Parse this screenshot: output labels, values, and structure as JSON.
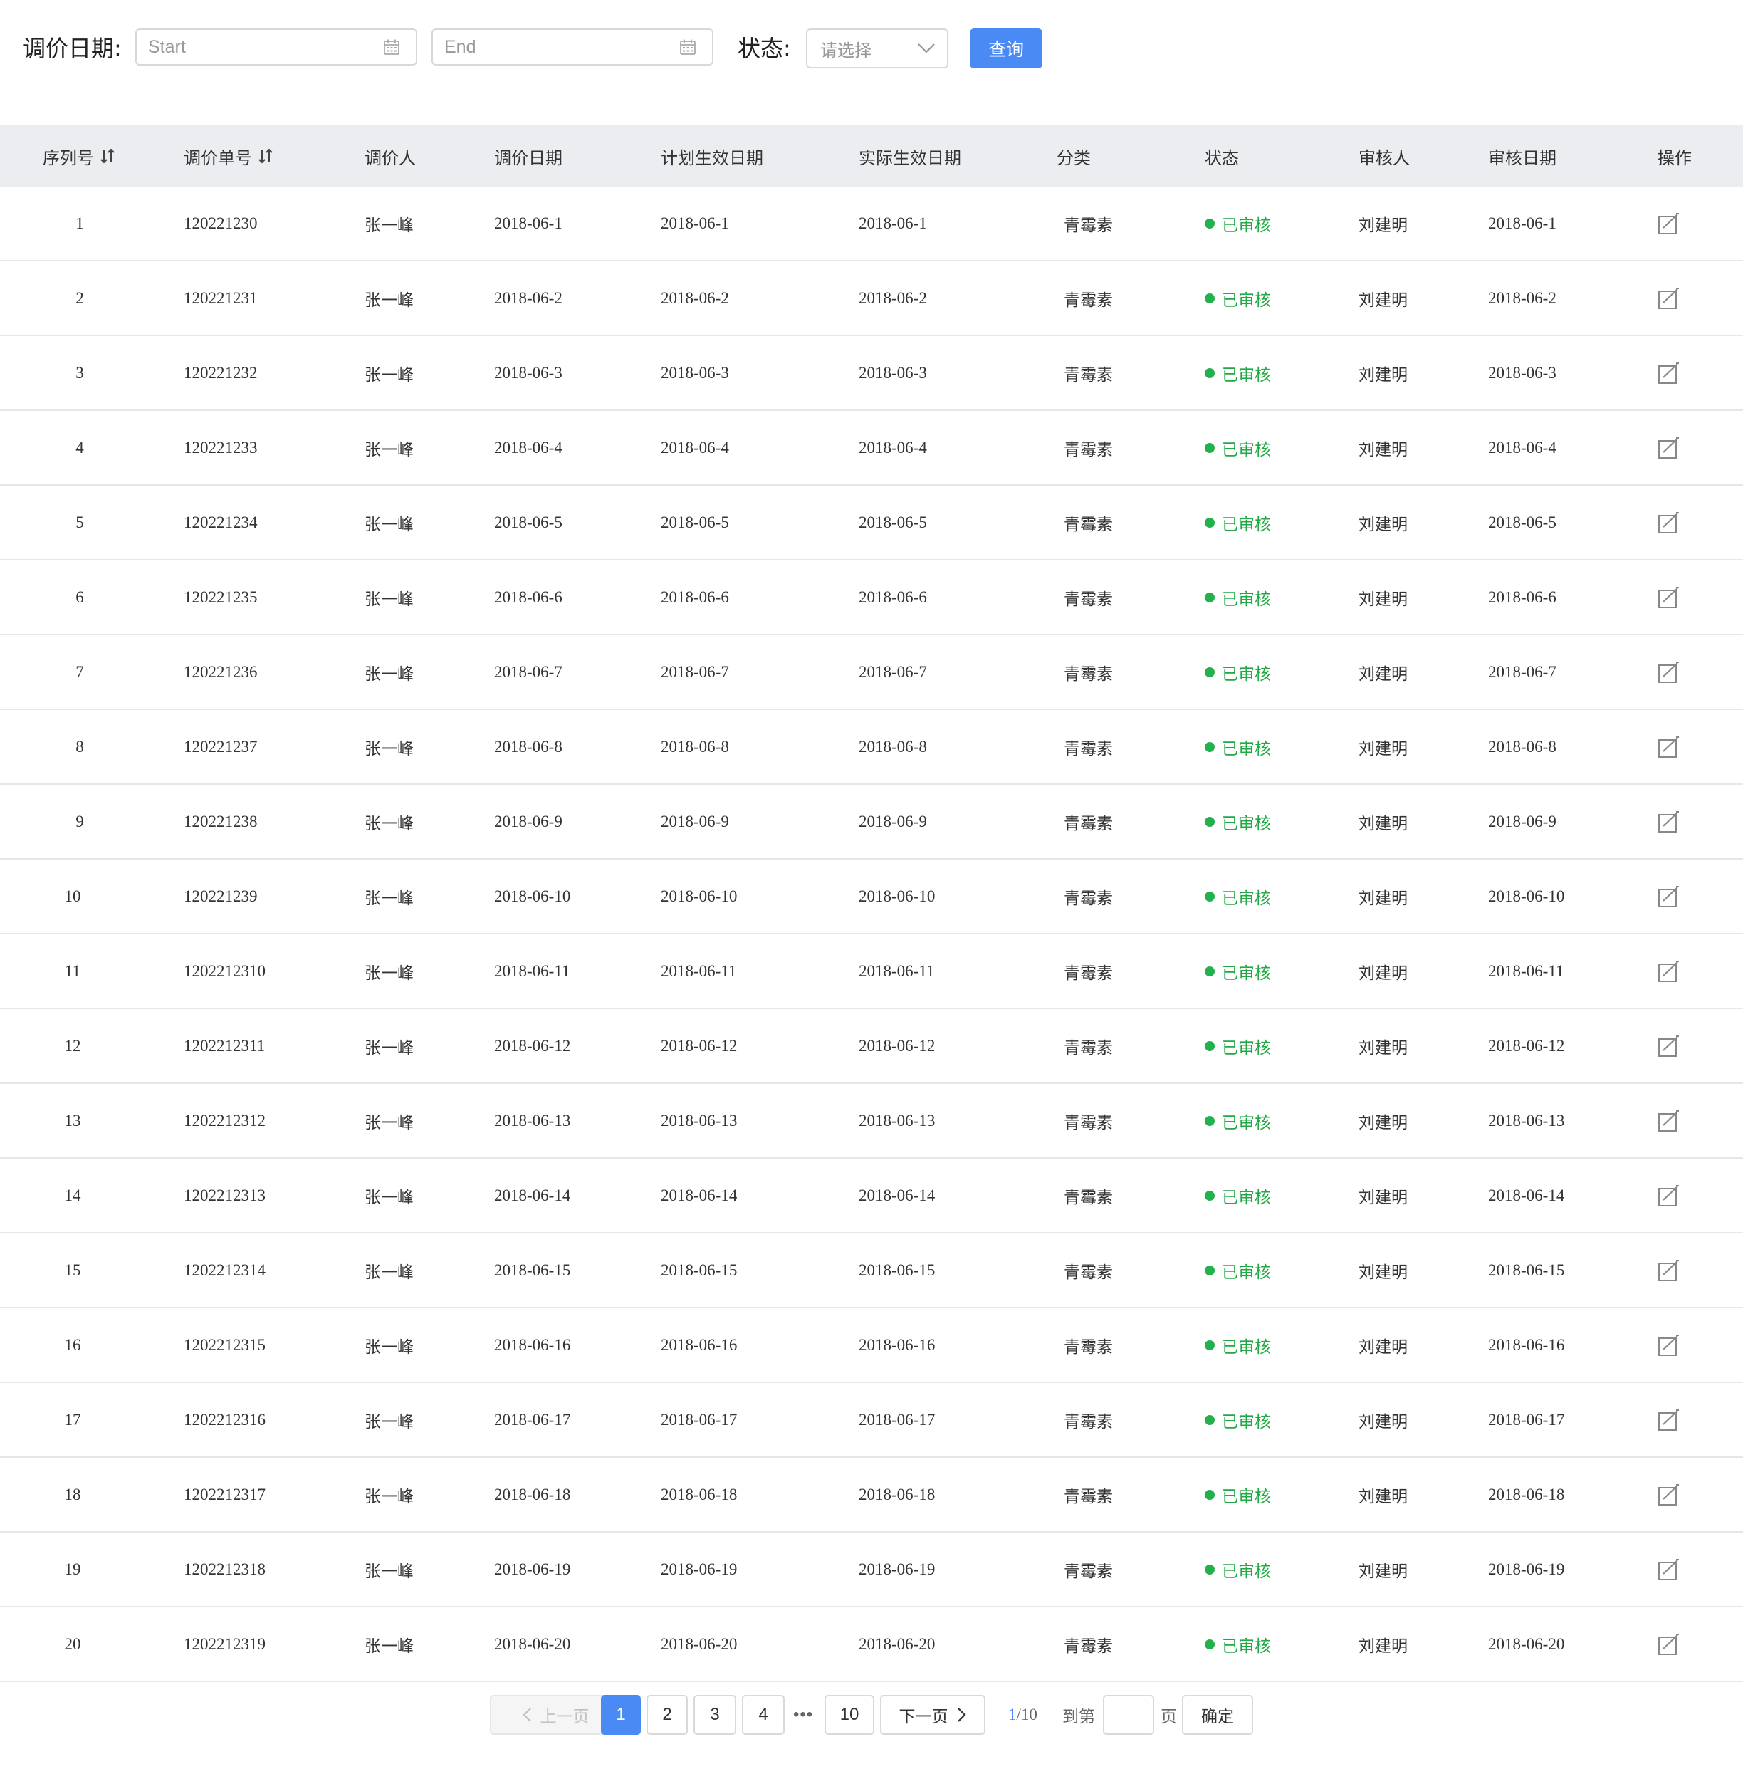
{
  "filter": {
    "date_label": "调价日期:",
    "start_placeholder": "Start",
    "end_placeholder": "End",
    "status_label": "状态:",
    "status_placeholder": "请选择",
    "query_button": "查询"
  },
  "table": {
    "columns": [
      "序列号",
      "调价单号",
      "调价人",
      "调价日期",
      "计划生效日期",
      "实际生效日期",
      "分类",
      "状态",
      "审核人",
      "审核日期",
      "操作"
    ],
    "sortable_columns": [
      "序列号",
      "调价单号"
    ],
    "status_color": "#22a845",
    "rows": [
      {
        "seq": "1",
        "order": "120221230",
        "person": "张一峰",
        "date": "2018-06-1",
        "planned": "2018-06-1",
        "actual": "2018-06-1",
        "category": "青霉素",
        "status": "已审核",
        "reviewer": "刘建明",
        "review_date": "2018-06-1"
      },
      {
        "seq": "2",
        "order": "120221231",
        "person": "张一峰",
        "date": "2018-06-2",
        "planned": "2018-06-2",
        "actual": "2018-06-2",
        "category": "青霉素",
        "status": "已审核",
        "reviewer": "刘建明",
        "review_date": "2018-06-2"
      },
      {
        "seq": "3",
        "order": "120221232",
        "person": "张一峰",
        "date": "2018-06-3",
        "planned": "2018-06-3",
        "actual": "2018-06-3",
        "category": "青霉素",
        "status": "已审核",
        "reviewer": "刘建明",
        "review_date": "2018-06-3"
      },
      {
        "seq": "4",
        "order": "120221233",
        "person": "张一峰",
        "date": "2018-06-4",
        "planned": "2018-06-4",
        "actual": "2018-06-4",
        "category": "青霉素",
        "status": "已审核",
        "reviewer": "刘建明",
        "review_date": "2018-06-4"
      },
      {
        "seq": "5",
        "order": "120221234",
        "person": "张一峰",
        "date": "2018-06-5",
        "planned": "2018-06-5",
        "actual": "2018-06-5",
        "category": "青霉素",
        "status": "已审核",
        "reviewer": "刘建明",
        "review_date": "2018-06-5"
      },
      {
        "seq": "6",
        "order": "120221235",
        "person": "张一峰",
        "date": "2018-06-6",
        "planned": "2018-06-6",
        "actual": "2018-06-6",
        "category": "青霉素",
        "status": "已审核",
        "reviewer": "刘建明",
        "review_date": "2018-06-6"
      },
      {
        "seq": "7",
        "order": "120221236",
        "person": "张一峰",
        "date": "2018-06-7",
        "planned": "2018-06-7",
        "actual": "2018-06-7",
        "category": "青霉素",
        "status": "已审核",
        "reviewer": "刘建明",
        "review_date": "2018-06-7"
      },
      {
        "seq": "8",
        "order": "120221237",
        "person": "张一峰",
        "date": "2018-06-8",
        "planned": "2018-06-8",
        "actual": "2018-06-8",
        "category": "青霉素",
        "status": "已审核",
        "reviewer": "刘建明",
        "review_date": "2018-06-8"
      },
      {
        "seq": "9",
        "order": "120221238",
        "person": "张一峰",
        "date": "2018-06-9",
        "planned": "2018-06-9",
        "actual": "2018-06-9",
        "category": "青霉素",
        "status": "已审核",
        "reviewer": "刘建明",
        "review_date": "2018-06-9"
      },
      {
        "seq": "10",
        "order": "120221239",
        "person": "张一峰",
        "date": "2018-06-10",
        "planned": "2018-06-10",
        "actual": "2018-06-10",
        "category": "青霉素",
        "status": "已审核",
        "reviewer": "刘建明",
        "review_date": "2018-06-10"
      },
      {
        "seq": "11",
        "order": "1202212310",
        "person": "张一峰",
        "date": "2018-06-11",
        "planned": "2018-06-11",
        "actual": "2018-06-11",
        "category": "青霉素",
        "status": "已审核",
        "reviewer": "刘建明",
        "review_date": "2018-06-11"
      },
      {
        "seq": "12",
        "order": "1202212311",
        "person": "张一峰",
        "date": "2018-06-12",
        "planned": "2018-06-12",
        "actual": "2018-06-12",
        "category": "青霉素",
        "status": "已审核",
        "reviewer": "刘建明",
        "review_date": "2018-06-12"
      },
      {
        "seq": "13",
        "order": "1202212312",
        "person": "张一峰",
        "date": "2018-06-13",
        "planned": "2018-06-13",
        "actual": "2018-06-13",
        "category": "青霉素",
        "status": "已审核",
        "reviewer": "刘建明",
        "review_date": "2018-06-13"
      },
      {
        "seq": "14",
        "order": "1202212313",
        "person": "张一峰",
        "date": "2018-06-14",
        "planned": "2018-06-14",
        "actual": "2018-06-14",
        "category": "青霉素",
        "status": "已审核",
        "reviewer": "刘建明",
        "review_date": "2018-06-14"
      },
      {
        "seq": "15",
        "order": "1202212314",
        "person": "张一峰",
        "date": "2018-06-15",
        "planned": "2018-06-15",
        "actual": "2018-06-15",
        "category": "青霉素",
        "status": "已审核",
        "reviewer": "刘建明",
        "review_date": "2018-06-15"
      },
      {
        "seq": "16",
        "order": "1202212315",
        "person": "张一峰",
        "date": "2018-06-16",
        "planned": "2018-06-16",
        "actual": "2018-06-16",
        "category": "青霉素",
        "status": "已审核",
        "reviewer": "刘建明",
        "review_date": "2018-06-16"
      },
      {
        "seq": "17",
        "order": "1202212316",
        "person": "张一峰",
        "date": "2018-06-17",
        "planned": "2018-06-17",
        "actual": "2018-06-17",
        "category": "青霉素",
        "status": "已审核",
        "reviewer": "刘建明",
        "review_date": "2018-06-17"
      },
      {
        "seq": "18",
        "order": "1202212317",
        "person": "张一峰",
        "date": "2018-06-18",
        "planned": "2018-06-18",
        "actual": "2018-06-18",
        "category": "青霉素",
        "status": "已审核",
        "reviewer": "刘建明",
        "review_date": "2018-06-18"
      },
      {
        "seq": "19",
        "order": "1202212318",
        "person": "张一峰",
        "date": "2018-06-19",
        "planned": "2018-06-19",
        "actual": "2018-06-19",
        "category": "青霉素",
        "status": "已审核",
        "reviewer": "刘建明",
        "review_date": "2018-06-19"
      },
      {
        "seq": "20",
        "order": "1202212319",
        "person": "张一峰",
        "date": "2018-06-20",
        "planned": "2018-06-20",
        "actual": "2018-06-20",
        "category": "青霉素",
        "status": "已审核",
        "reviewer": "刘建明",
        "review_date": "2018-06-20"
      }
    ]
  },
  "pagination": {
    "prev_label": "上一页",
    "next_label": "下一页",
    "pages": [
      "1",
      "2",
      "3",
      "4"
    ],
    "ellipsis": "•••",
    "last_page": "10",
    "current_page": "1",
    "page_info_current": "1",
    "page_info_total": "/10",
    "goto_label": "到第",
    "page_suffix": "页",
    "confirm_label": "确定",
    "accent_color": "#4a8af4"
  }
}
